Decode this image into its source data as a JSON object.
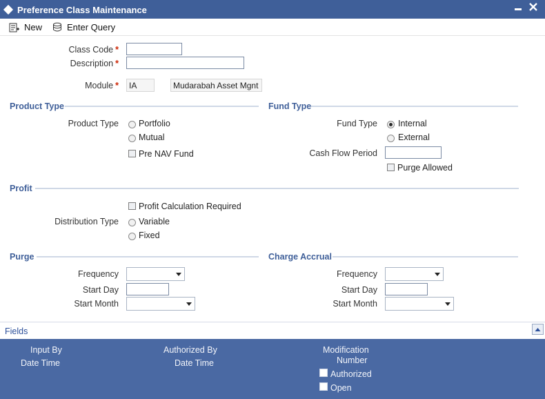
{
  "window": {
    "title": "Preference Class Maintenance",
    "minimize_glyph": "▬",
    "close_glyph": "✕"
  },
  "toolbar": {
    "new_label": "New",
    "enter_query_label": "Enter Query"
  },
  "header": {
    "class_code_label": "Class Code",
    "class_code_value": "",
    "description_label": "Description",
    "description_value": "",
    "module_label": "Module",
    "module_value": "IA",
    "module_desc": "Mudarabah Asset Mgnt",
    "required_mark": "*"
  },
  "product_type": {
    "section_title": "Product Type",
    "field_label": "Product Type",
    "options": [
      "Portfolio",
      "Mutual"
    ],
    "selected": null,
    "pre_nav_label": "Pre NAV Fund",
    "pre_nav_checked": false
  },
  "fund_type": {
    "section_title": "Fund Type",
    "field_label": "Fund Type",
    "options": [
      "Internal",
      "External"
    ],
    "selected": "Internal",
    "cash_flow_label": "Cash Flow Period",
    "cash_flow_value": "",
    "purge_allowed_label": "Purge Allowed",
    "purge_allowed_checked": false
  },
  "profit": {
    "section_title": "Profit",
    "calc_required_label": "Profit Calculation Required",
    "calc_required_checked": false,
    "distribution_label": "Distribution Type",
    "options": [
      "Variable",
      "Fixed"
    ],
    "selected": null
  },
  "purge": {
    "section_title": "Purge",
    "frequency_label": "Frequency",
    "frequency_value": "",
    "start_day_label": "Start Day",
    "start_day_value": "",
    "start_month_label": "Start Month",
    "start_month_value": ""
  },
  "charge_accrual": {
    "section_title": "Charge Accrual",
    "frequency_label": "Frequency",
    "frequency_value": "",
    "start_day_label": "Start Day",
    "start_day_value": "",
    "start_month_label": "Start Month",
    "start_month_value": ""
  },
  "fields_bar": {
    "label": "Fields"
  },
  "footer": {
    "input_by": "Input By",
    "date_time_1": "Date Time",
    "authorized_by": "Authorized By",
    "date_time_2": "Date Time",
    "modification": "Modification",
    "number": "Number",
    "authorized_label": "Authorized",
    "open_label": "Open"
  },
  "colors": {
    "title_bar": "#3f5f99",
    "footer": "#4a69a3",
    "section_title": "#3f5f99",
    "required": "#cc2200"
  },
  "icons": {
    "new": "new-record-icon",
    "enter_query": "query-icon",
    "collapse": "collapse-up-icon"
  }
}
